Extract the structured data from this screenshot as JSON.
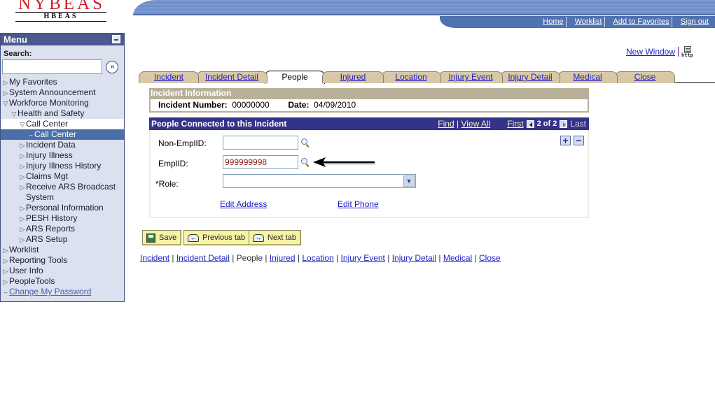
{
  "logo": {
    "main": "NYBEAS",
    "sub": "HBEAS"
  },
  "header_nav": [
    "Home",
    "Worklist",
    "Add to Favorites",
    "Sign out"
  ],
  "new_window": {
    "label": "New Window",
    "http_icon": "http-icon",
    "http_text": "http"
  },
  "sidebar": {
    "title": "Menu",
    "search_label": "Search:",
    "search_value": "",
    "search_go_icon": "»",
    "items": [
      {
        "label": "My Favorites",
        "level": 0,
        "state": "collapsed"
      },
      {
        "label": "System Announcement",
        "level": 0,
        "state": "collapsed"
      },
      {
        "label": "Workforce Monitoring",
        "level": 0,
        "state": "expanded"
      },
      {
        "label": "Health and Safety",
        "level": 1,
        "state": "expanded"
      },
      {
        "label": "Call Center",
        "level": 2,
        "state": "expanded"
      },
      {
        "label": "Call Center",
        "level": 3,
        "state": "selected"
      },
      {
        "label": "Incident Data",
        "level": 2,
        "state": "collapsed"
      },
      {
        "label": "Injury Illness",
        "level": 2,
        "state": "collapsed"
      },
      {
        "label": "Injury Illness History",
        "level": 2,
        "state": "collapsed"
      },
      {
        "label": "Claims Mgt",
        "level": 2,
        "state": "collapsed"
      },
      {
        "label": "Receive ARS Broadcast System",
        "level": 2,
        "state": "collapsed"
      },
      {
        "label": "Personal Information",
        "level": 2,
        "state": "collapsed"
      },
      {
        "label": "PESH History",
        "level": 2,
        "state": "collapsed"
      },
      {
        "label": "ARS Reports",
        "level": 2,
        "state": "collapsed"
      },
      {
        "label": "ARS Setup",
        "level": 2,
        "state": "collapsed"
      },
      {
        "label": "Worklist",
        "level": 0,
        "state": "collapsed"
      },
      {
        "label": "Reporting Tools",
        "level": 0,
        "state": "collapsed"
      },
      {
        "label": "User Info",
        "level": 0,
        "state": "collapsed"
      },
      {
        "label": "PeopleTools",
        "level": 0,
        "state": "collapsed"
      },
      {
        "label": "Change My Password",
        "level": 0,
        "state": "link"
      }
    ]
  },
  "tabs": [
    {
      "label": "Incident",
      "active": false
    },
    {
      "label": "Incident Detail",
      "active": false
    },
    {
      "label": "People",
      "active": true
    },
    {
      "label": "Injured",
      "active": false
    },
    {
      "label": "Location",
      "active": false
    },
    {
      "label": "Injury Event",
      "active": false
    },
    {
      "label": "Injury Detail",
      "active": false
    },
    {
      "label": "Medical",
      "active": false
    },
    {
      "label": "Close",
      "active": false
    }
  ],
  "incident_info": {
    "title": "Incident Information",
    "number_label": "Incident Number:",
    "number_value": "00000000",
    "date_label": "Date:",
    "date_value": "04/09/2010"
  },
  "people": {
    "title": "People Connected to this Incident",
    "find": "Find",
    "view_all": "View All",
    "first": "First",
    "page_status": "2 of 2",
    "last": "Last",
    "non_emplid_label": "Non-EmplID:",
    "non_emplid_value": "",
    "emplid_label": "EmplID:",
    "emplid_value": "999999998",
    "role_label": "*Role:",
    "role_value": "",
    "edit_address": "Edit Address",
    "edit_phone": "Edit Phone",
    "add_row": "+",
    "delete_row": "−"
  },
  "buttons": {
    "save": "Save",
    "previous_tab": "Previous tab",
    "next_tab": "Next tab"
  },
  "bottom_nav": [
    "Incident",
    "Incident Detail",
    "People",
    "Injured",
    "Location",
    "Injury Event",
    "Injury Detail",
    "Medical",
    "Close"
  ],
  "bottom_nav_current": "People",
  "colors": {
    "banner_blue": "#6d8cc8",
    "sidebar_header": "#4a5a8f",
    "section_header": "#33338a",
    "tab_tan": "#d9c8a7",
    "incident_header": "#b8b098",
    "button_yellow": "#f6f2a8"
  }
}
